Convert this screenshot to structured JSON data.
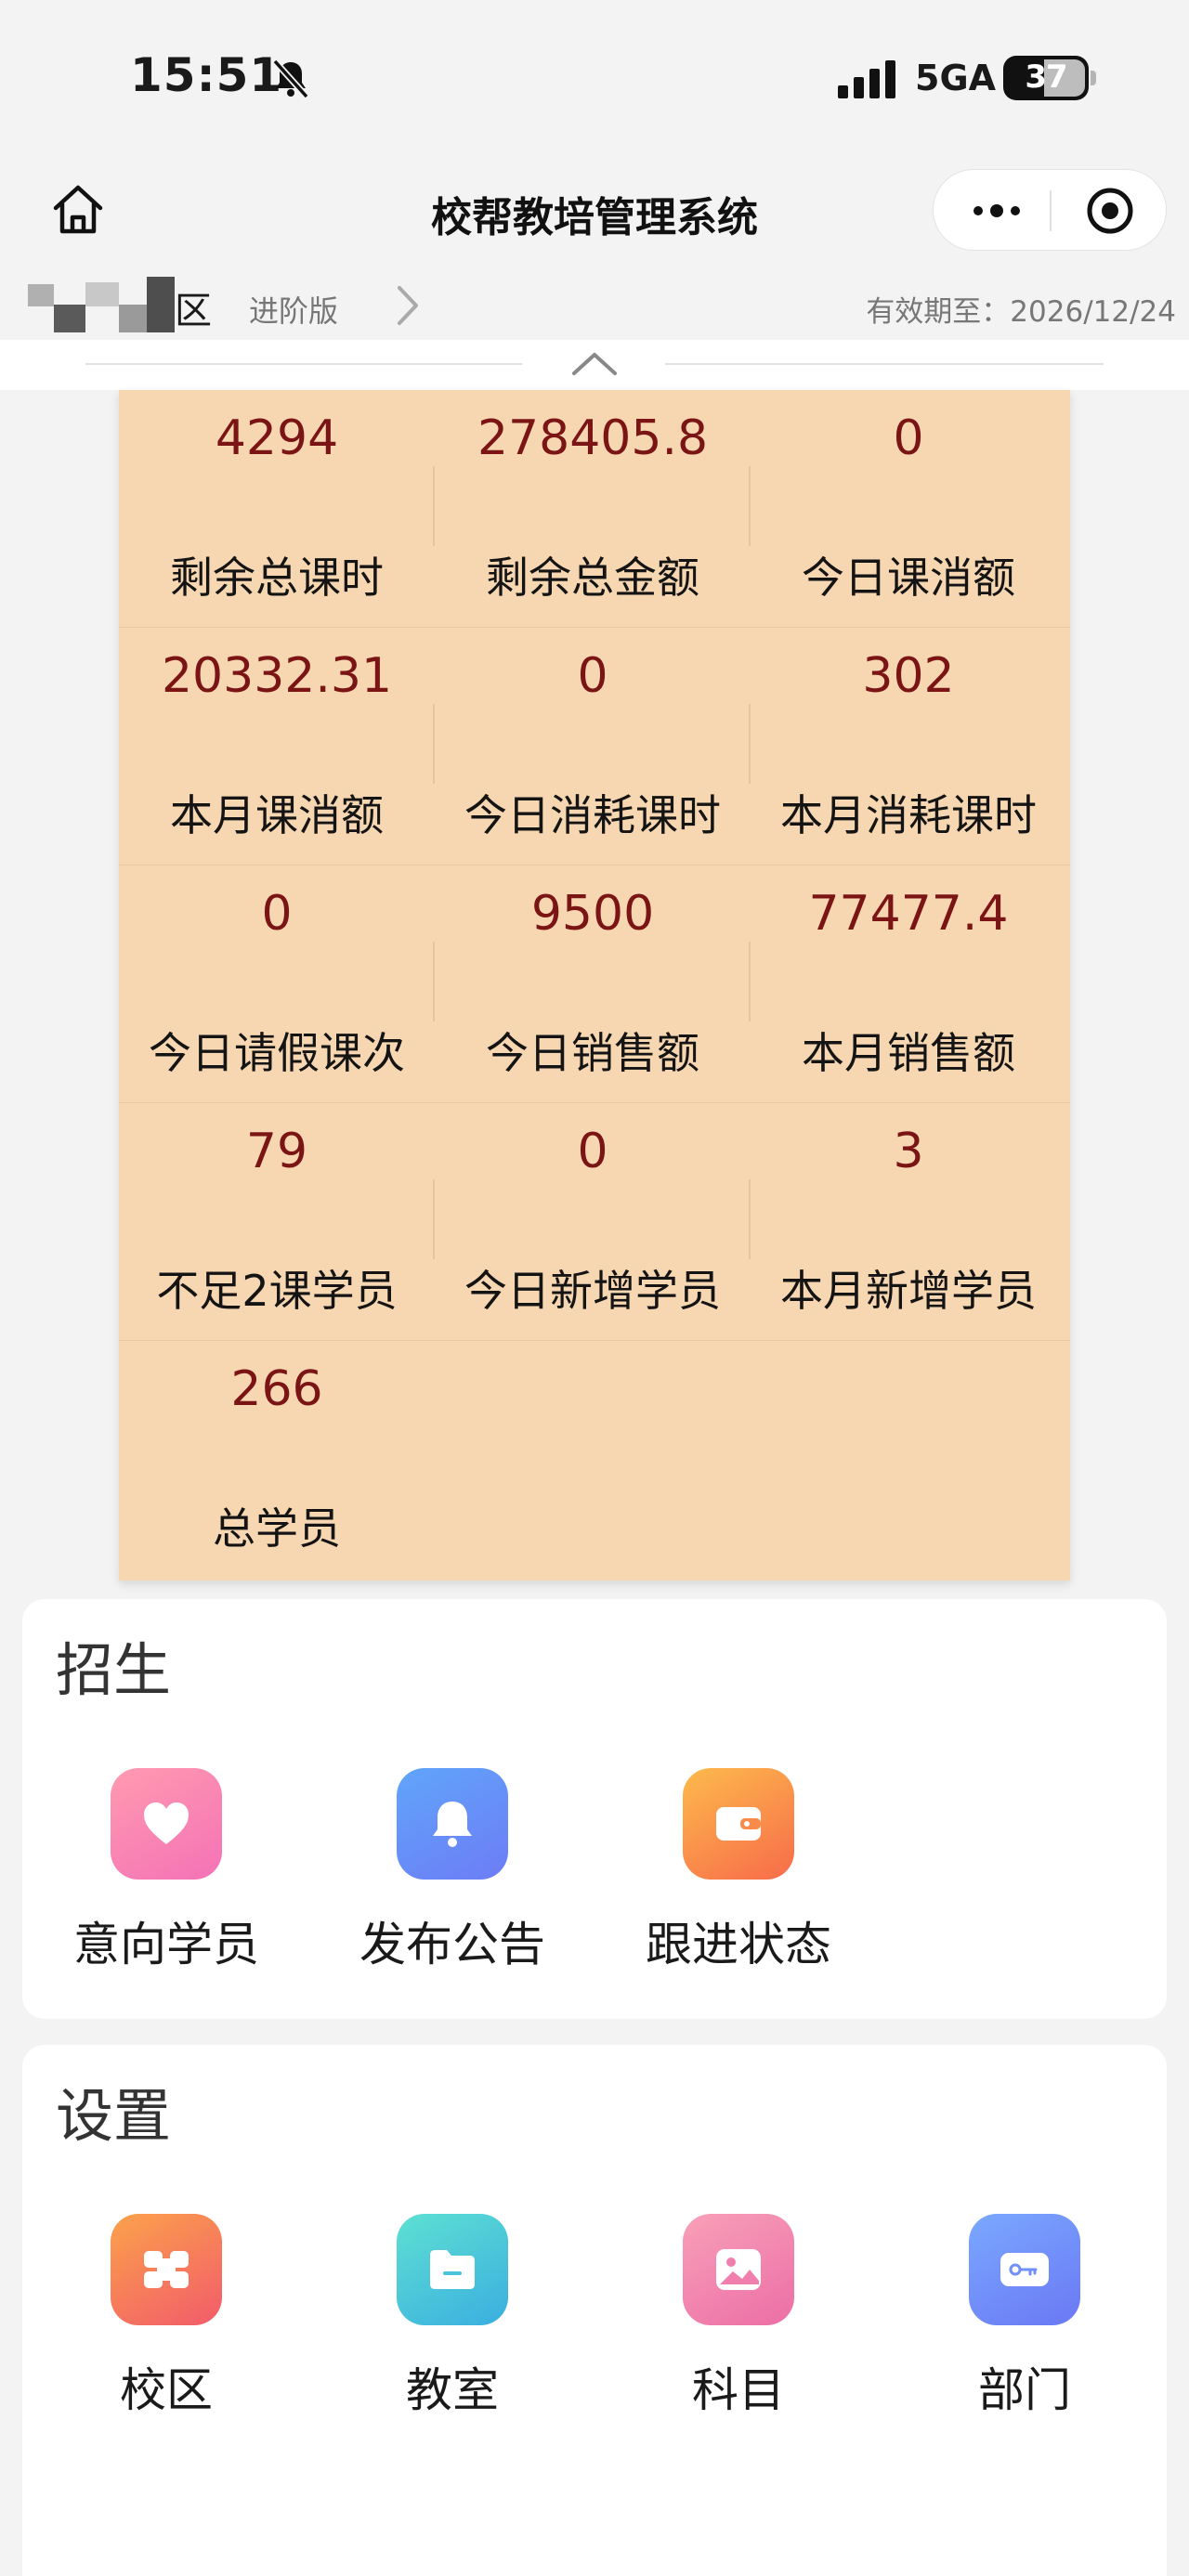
{
  "status_bar": {
    "time": "15:51",
    "network": "5GA",
    "battery": "37"
  },
  "nav": {
    "title": "校帮教培管理系统"
  },
  "campus": {
    "name": "区",
    "plan": "进阶版",
    "expiry": "有效期至：2026/12/24"
  },
  "stats": [
    {
      "value": "4294",
      "label": "剩余总课时"
    },
    {
      "value": "278405.8",
      "label": "剩余总金额"
    },
    {
      "value": "0",
      "label": "今日课消额"
    },
    {
      "value": "20332.31",
      "label": "本月课消额"
    },
    {
      "value": "0",
      "label": "今日消耗课时"
    },
    {
      "value": "302",
      "label": "本月消耗课时"
    },
    {
      "value": "0",
      "label": "今日请假课次"
    },
    {
      "value": "9500",
      "label": "今日销售额"
    },
    {
      "value": "77477.4",
      "label": "本月销售额"
    },
    {
      "value": "79",
      "label": "不足2课学员"
    },
    {
      "value": "0",
      "label": "今日新增学员"
    },
    {
      "value": "3",
      "label": "本月新增学员"
    },
    {
      "value": "266",
      "label": "总学员"
    }
  ],
  "recruit": {
    "title": "招生",
    "items": [
      {
        "label": "意向学员",
        "icon": "heart-icon",
        "color_from": "#ff9ab0",
        "color_to": "#f472b6"
      },
      {
        "label": "发布公告",
        "icon": "bell-icon",
        "color_from": "#60a5fa",
        "color_to": "#6d7cf6"
      },
      {
        "label": "跟进状态",
        "icon": "wallet-icon",
        "color_from": "#fdba4c",
        "color_to": "#f76b4a"
      }
    ]
  },
  "settings": {
    "title": "设置",
    "items": [
      {
        "label": "校区",
        "icon": "campus-icon",
        "color_from": "#fba24b",
        "color_to": "#f25b6a"
      },
      {
        "label": "教室",
        "icon": "folder-icon",
        "color_from": "#5ee0d2",
        "color_to": "#3aaee0"
      },
      {
        "label": "科目",
        "icon": "image-icon",
        "color_from": "#f8a0b8",
        "color_to": "#ec6ea6"
      },
      {
        "label": "部门",
        "icon": "key-card-icon",
        "color_from": "#7aa8ff",
        "color_to": "#6a78f4"
      }
    ]
  },
  "colors": {
    "card_bg": "#f7d7b2",
    "stat_value": "#7b1414",
    "page_bg": "#f3f3f3"
  }
}
